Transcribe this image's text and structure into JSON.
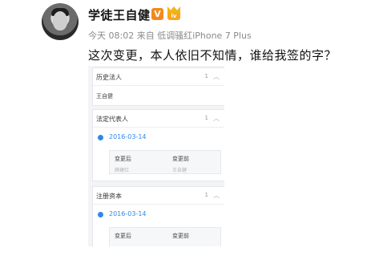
{
  "post": {
    "username": "学徒王自健",
    "vip_badge": "V",
    "level_badge": "lv",
    "meta": "今天 08:02 来自 低调骚红iPhone 7 Plus",
    "text": "这次变更，本人依旧不知情，谁给我签的字？",
    "icons": [
      "avatar",
      "vip-icon",
      "crown-level-icon"
    ]
  },
  "screenshot": {
    "sections": [
      {
        "title": "历史法人",
        "count": "1",
        "value": "王自健"
      },
      {
        "title": "法定代表人",
        "count": "1",
        "date": "2016-03-14",
        "after_label": "变更后",
        "before_label": "变更前",
        "after_value": "薛建红",
        "before_value": "王自健"
      },
      {
        "title": "注册资本",
        "count": "1",
        "date": "2016-03-14",
        "after_label": "变更后",
        "before_label": "变更前"
      }
    ],
    "toggle_icon": "chevron-up-icon",
    "accent_color": "#2f88ea"
  }
}
